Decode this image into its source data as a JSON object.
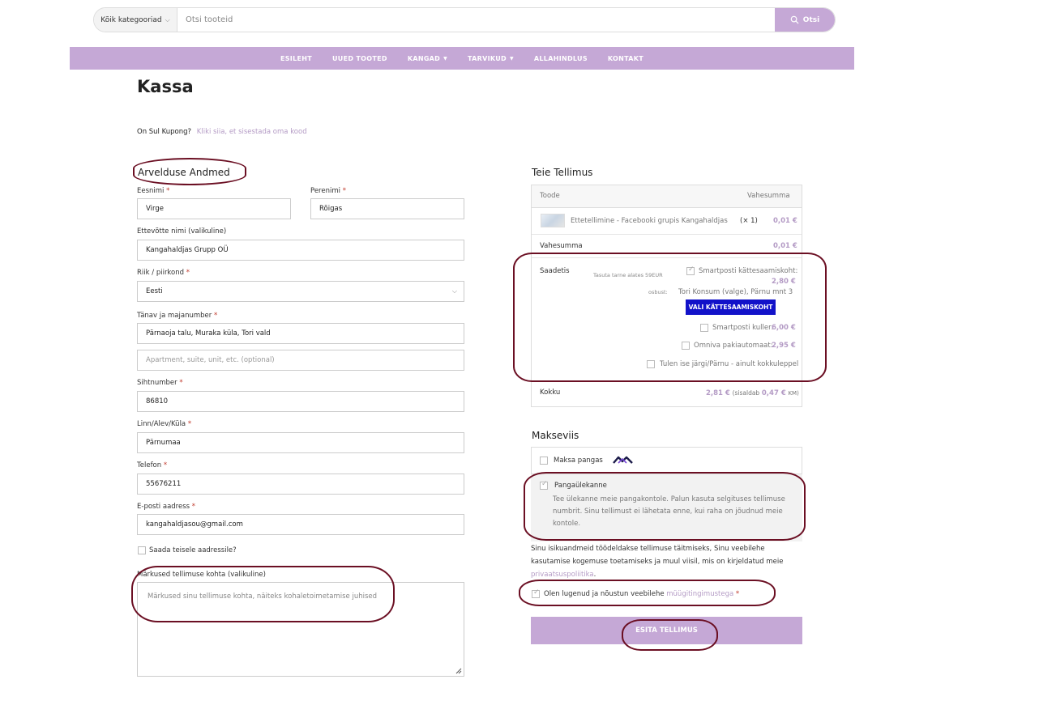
{
  "search": {
    "category": "Kõik kategooriad",
    "placeholder": "Otsi tooteid",
    "button": "Otsi"
  },
  "nav": {
    "items": [
      {
        "label": "ESILEHT"
      },
      {
        "label": "UUED TOOTED"
      },
      {
        "label": "KANGAD"
      },
      {
        "label": "TARVIKUD"
      },
      {
        "label": "ALLAHINDLUS"
      },
      {
        "label": "KONTAKT"
      }
    ]
  },
  "page": {
    "title": "Kassa",
    "coupon_text": "On Sul Kupong?",
    "coupon_link": "Kliki siia, et sisestada oma kood"
  },
  "billing": {
    "title": "Arvelduse Andmed",
    "first_name_label": "Eesnimi",
    "first_name": "Virge",
    "last_name_label": "Perenimi",
    "last_name": "Rõigas",
    "company_label": "Ettevõtte nimi (valikuline)",
    "company": "Kangahaldjas Grupp OÜ",
    "country_label": "Riik / piirkond",
    "country": "Eesti",
    "street_label": "Tänav ja majanumber",
    "street": "Pärnaoja talu, Muraka küla, Tori vald",
    "apartment_placeholder": "Apartment, suite, unit, etc. (optional)",
    "postcode_label": "Sihtnumber",
    "postcode": "86810",
    "city_label": "Linn/Alev/Küla",
    "city": "Pärnumaa",
    "phone_label": "Telefon",
    "phone": "55676211",
    "email_label": "E-posti aadress",
    "email": "kangahaldjasou@gmail.com",
    "ship_other_label": "Saada teisele aadressile?",
    "notes_label": "Märkused tellimuse kohta (valikuline)",
    "notes_placeholder": "Märkused sinu tellimuse kohta, näiteks kohaletoimetamise juhised",
    "required_mark": "*"
  },
  "order": {
    "title": "Teie Tellimus",
    "col_product": "Toode",
    "col_subtotal": "Vahesumma",
    "product_name": "Ettetellimine - Facebooki grupis Kangahaldjas",
    "product_qty": "(× 1)",
    "product_price": "0,01 €",
    "subtotal_label": "Vahesumma",
    "subtotal": "0,01 €",
    "shipping_label": "Saadetis",
    "free_note": "Tasuta tarne alates 59EUR",
    "smartpost_pickup": "Smartposti kättesaamiskoht:",
    "smartpost_pickup_price": "2,80 €",
    "choice_label": "osbust:",
    "choice_value": "Tori Konsum (valge), Pärnu mnt 3",
    "pick_button": "VALI KÄTTESAAMISKOHT",
    "smartpost_courier": "Smartposti kuller:",
    "smartpost_courier_price": "6,00 €",
    "omniva": "Omniva pakiautomaat:",
    "omniva_price": "2,95 €",
    "self_pickup": "Tulen ise järgi/Pärnu - ainult kokkuleppel",
    "total_label": "Kokku",
    "total": "2,81 €",
    "tax_prefix": "(sisaldab",
    "tax": "0,47 €",
    "tax_suffix": "KM)"
  },
  "payment": {
    "title": "Makseviis",
    "bank_link": "Maksa pangas",
    "transfer": "Pangaülekanne",
    "transfer_desc": "Tee ülekanne meie pangakontole. Palun kasuta selgituses tellimuse numbrit. Sinu tellimust ei lähetata enne, kui raha on jõudnud meie kontole.",
    "privacy_text": "Sinu isikuandmeid töödeldakse tellimuse täitmiseks, Sinu veebilehe kasutamise kogemuse toetamiseks ja muul viisil, mis on kirjeldatud meie",
    "privacy_link": "privaatsuspoliitika",
    "privacy_end": ".",
    "terms_text": "Olen lugenud ja nõustun veebilehe",
    "terms_link": "müügitingimustega",
    "terms_req": "*",
    "submit": "ESITA TELLIMUS"
  },
  "colors": {
    "accent": "#c5a8d6",
    "link": "#b49bc5",
    "annotation": "#6b0f23",
    "pick_button": "#1212c9"
  }
}
